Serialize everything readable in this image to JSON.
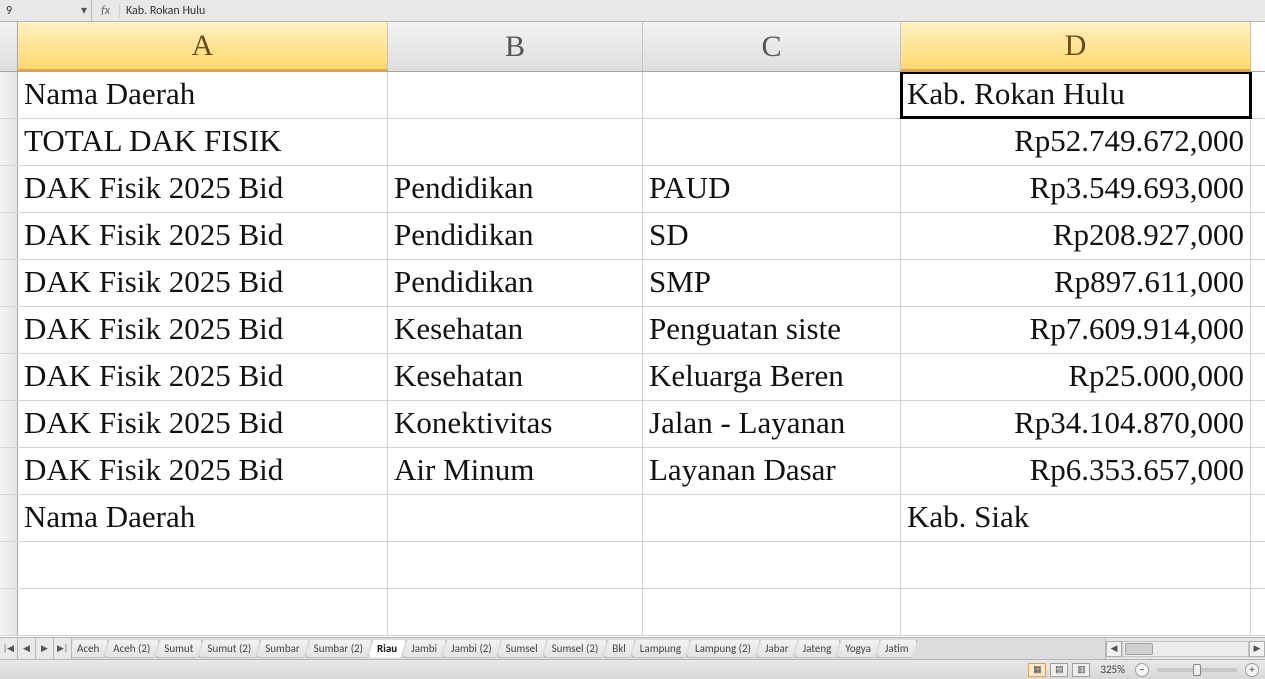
{
  "formula_bar": {
    "cell_ref_visible": "9",
    "fx_label": "fx",
    "formula_text": "Kab. Rokan Hulu"
  },
  "columns": [
    {
      "label": "A",
      "width_class": "wA",
      "selected": true
    },
    {
      "label": "B",
      "width_class": "wB",
      "selected": false
    },
    {
      "label": "C",
      "width_class": "wC",
      "selected": false
    },
    {
      "label": "D",
      "width_class": "wD",
      "selected": true
    }
  ],
  "active_cell": {
    "row": 0,
    "col": 3
  },
  "rows": [
    {
      "A": "Nama Daerah",
      "B": "",
      "C": "",
      "D": "Kab. Rokan Hulu",
      "D_align": "left"
    },
    {
      "A": "TOTAL DAK FISIK",
      "B": "",
      "C": "",
      "D": "Rp52.749.672,000",
      "D_align": "right"
    },
    {
      "A": "DAK Fisik 2025 Bid",
      "B": "Pendidikan",
      "C": "PAUD",
      "D": "Rp3.549.693,000",
      "D_align": "right"
    },
    {
      "A": "DAK Fisik 2025 Bid",
      "B": "Pendidikan",
      "C": "SD",
      "D": "Rp208.927,000",
      "D_align": "right"
    },
    {
      "A": "DAK Fisik 2025 Bid",
      "B": "Pendidikan",
      "C": "SMP",
      "D": "Rp897.611,000",
      "D_align": "right"
    },
    {
      "A": "DAK Fisik 2025 Bid",
      "B": "Kesehatan",
      "C": "Penguatan siste",
      "D": "Rp7.609.914,000",
      "D_align": "right"
    },
    {
      "A": "DAK Fisik 2025 Bid",
      "B": "Kesehatan",
      "C": "Keluarga Beren",
      "D": "Rp25.000,000",
      "D_align": "right"
    },
    {
      "A": "DAK Fisik 2025 Bid",
      "B": "Konektivitas",
      "C": "Jalan - Layanan",
      "D": "Rp34.104.870,000",
      "D_align": "right"
    },
    {
      "A": "DAK Fisik 2025 Bid",
      "B": "Air Minum",
      "C": "Layanan Dasar",
      "D": "Rp6.353.657,000",
      "D_align": "right"
    },
    {
      "A": "Nama Daerah",
      "B": "",
      "C": "",
      "D": "Kab. Siak",
      "D_align": "left"
    }
  ],
  "sheet_tabs": {
    "list": [
      "Aceh",
      "Aceh (2)",
      "Sumut",
      "Sumut (2)",
      "Sumbar",
      "Sumbar (2)",
      "Riau",
      "Jambi",
      "Jambi (2)",
      "Sumsel",
      "Sumsel (2)",
      "Bkl",
      "Lampung",
      "Lampung (2)",
      "Jabar",
      "Jateng",
      "Yogya",
      "Jatim"
    ],
    "active": "Riau"
  },
  "status": {
    "zoom": "325%",
    "view_modes": [
      "normal",
      "layout",
      "break"
    ],
    "active_view": "normal"
  }
}
